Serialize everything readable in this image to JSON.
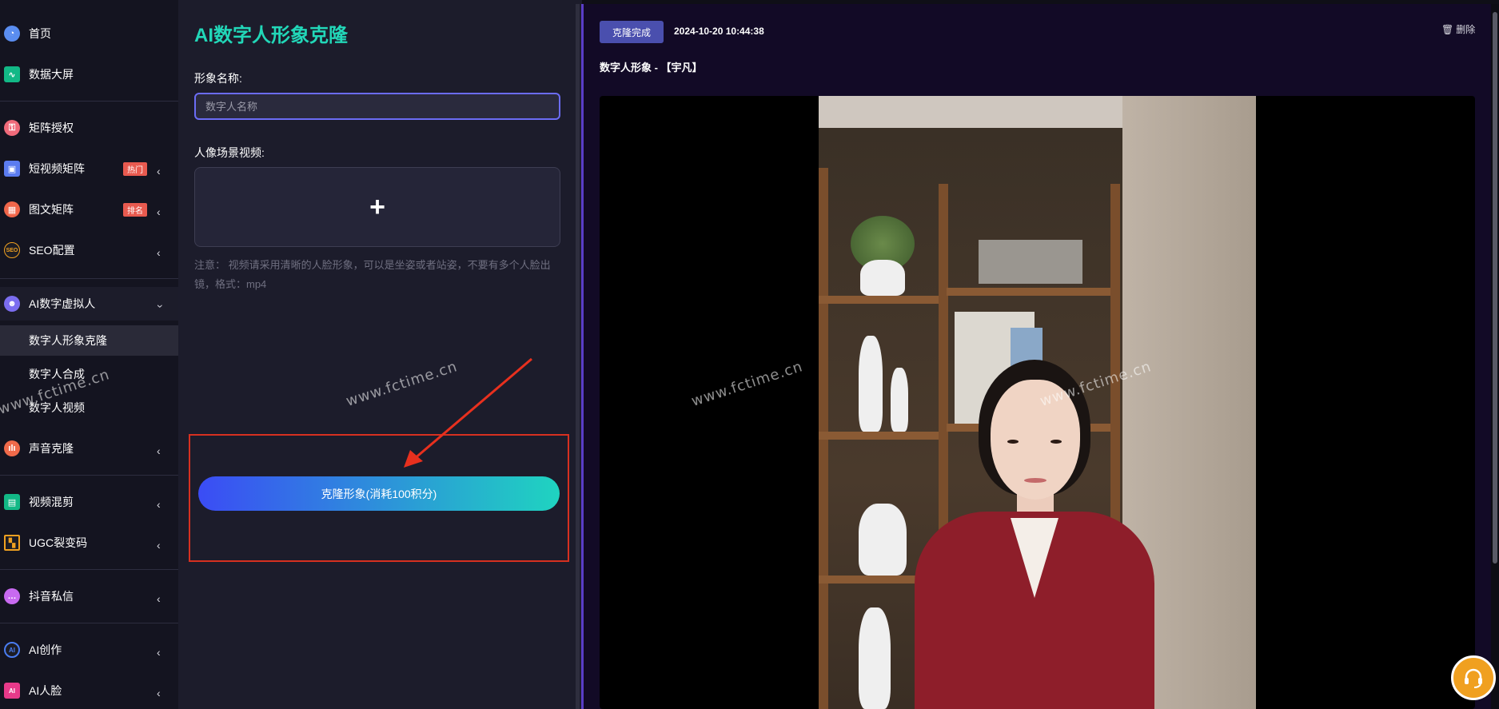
{
  "sidebar": {
    "items": [
      {
        "label": "首页",
        "icon": "pie-chart-icon"
      },
      {
        "label": "数据大屏",
        "icon": "line-chart-icon"
      },
      {
        "label": "矩阵授权",
        "icon": "authorize-icon"
      },
      {
        "label": "短视频矩阵",
        "icon": "video-matrix-icon",
        "badge": "热门"
      },
      {
        "label": "图文矩阵",
        "icon": "image-text-icon",
        "badge": "排名"
      },
      {
        "label": "SEO配置",
        "icon": "seo-icon"
      },
      {
        "label": "AI数字虚拟人",
        "icon": "avatar-users-icon"
      },
      {
        "label": "声音克隆",
        "icon": "sound-wave-icon"
      },
      {
        "label": "视频混剪",
        "icon": "clapper-icon"
      },
      {
        "label": "UGC裂变码",
        "icon": "qr-code-icon"
      },
      {
        "label": "抖音私信",
        "icon": "message-icon"
      },
      {
        "label": "AI创作",
        "icon": "ai-create-icon"
      },
      {
        "label": "AI人脸",
        "icon": "ai-face-icon"
      }
    ],
    "subitems": [
      {
        "label": "数字人形象克隆"
      },
      {
        "label": "数字人合成"
      },
      {
        "label": "数字人视频"
      }
    ]
  },
  "form": {
    "title": "AI数字人形象克隆",
    "name_label": "形象名称:",
    "name_placeholder": "数字人名称",
    "video_label": "人像场景视频:",
    "upload_symbol": "+",
    "note": "注意： 视频请采用清晰的人脸形象，可以是坐姿或者站姿，不要有多个人脸出镜，格式：mp4",
    "clone_button": "克隆形象(消耗100积分)"
  },
  "result": {
    "status": "克隆完成",
    "timestamp": "2024-10-20 10:44:38",
    "delete_label": "删除",
    "avatar_title": "数字人形象 - 【宇凡】"
  },
  "watermark": "www.fctime.cn",
  "colors": {
    "accent_teal": "#22d7b8",
    "input_border": "#6b6cf5",
    "status_button": "#4a4fae",
    "badge_red": "#e85a4f",
    "highlight_red": "#d63020",
    "button_gradient_start": "#3b4cf5",
    "button_gradient_end": "#1fd4c0"
  }
}
